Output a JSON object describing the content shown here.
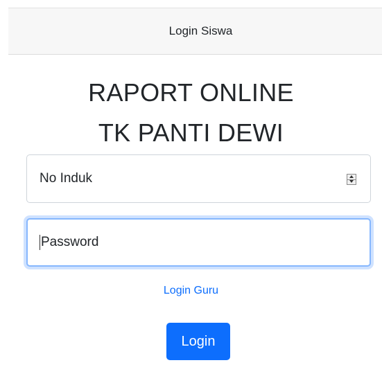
{
  "header": {
    "title": "Login Siswa"
  },
  "main": {
    "title_line1": "RAPORT ONLINE",
    "title_line2": "TK PANTI DEWI"
  },
  "form": {
    "no_induk": {
      "placeholder": "No Induk",
      "value": ""
    },
    "password": {
      "placeholder": "Password",
      "value": ""
    },
    "guru_link_label": "Login Guru",
    "login_button_label": "Login"
  },
  "colors": {
    "primary": "#0d6efd",
    "focus_border": "#86b7fe",
    "header_bg": "#f7f7f7"
  }
}
